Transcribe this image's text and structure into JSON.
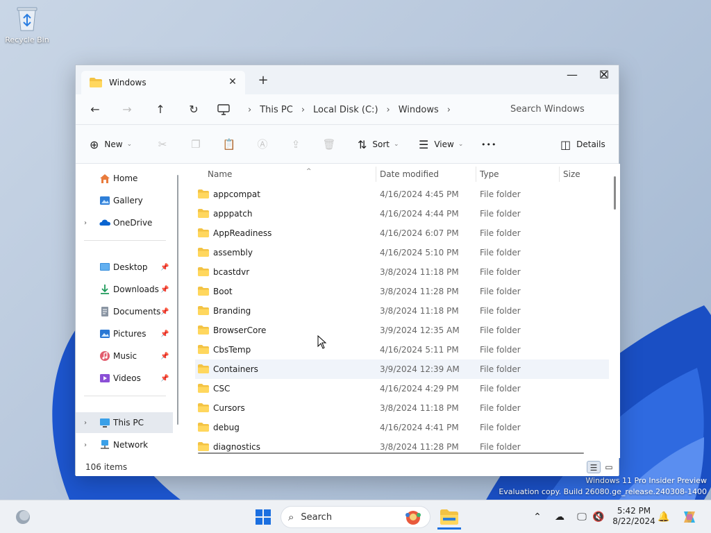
{
  "desktop": {
    "recycle_bin_label": "Recycle Bin",
    "watermark_line1": "Windows 11 Pro Insider Preview",
    "watermark_line2": "Evaluation copy. Build 26080.ge_release.240308-1400"
  },
  "window": {
    "tab_title": "Windows",
    "tab_close": "✕",
    "new_tab": "+",
    "minimize": "—",
    "maximize": "☐",
    "close": "✕"
  },
  "nav": {
    "back": "←",
    "forward": "→",
    "up": "↑",
    "refresh": "↻",
    "breadcrumb": [
      "This PC",
      "Local Disk (C:)",
      "Windows"
    ],
    "search_placeholder": "Search Windows"
  },
  "toolbar": {
    "new_label": "New",
    "sort_label": "Sort",
    "view_label": "View",
    "more_label": "•••",
    "details_label": "Details"
  },
  "sidebar": {
    "home": "Home",
    "gallery": "Gallery",
    "onedrive": "OneDrive",
    "desktop": "Desktop",
    "downloads": "Downloads",
    "documents": "Documents",
    "pictures": "Pictures",
    "music": "Music",
    "videos": "Videos",
    "this_pc": "This PC",
    "network": "Network"
  },
  "columns": {
    "name": "Name",
    "date": "Date modified",
    "type": "Type",
    "size": "Size"
  },
  "rows": [
    {
      "name": "appcompat",
      "date": "4/16/2024 4:45 PM",
      "type": "File folder"
    },
    {
      "name": "apppatch",
      "date": "4/16/2024 4:44 PM",
      "type": "File folder"
    },
    {
      "name": "AppReadiness",
      "date": "4/16/2024 6:07 PM",
      "type": "File folder"
    },
    {
      "name": "assembly",
      "date": "4/16/2024 5:10 PM",
      "type": "File folder"
    },
    {
      "name": "bcastdvr",
      "date": "3/8/2024 11:18 PM",
      "type": "File folder"
    },
    {
      "name": "Boot",
      "date": "3/8/2024 11:28 PM",
      "type": "File folder"
    },
    {
      "name": "Branding",
      "date": "3/8/2024 11:18 PM",
      "type": "File folder"
    },
    {
      "name": "BrowserCore",
      "date": "3/9/2024 12:35 AM",
      "type": "File folder"
    },
    {
      "name": "CbsTemp",
      "date": "4/16/2024 5:11 PM",
      "type": "File folder"
    },
    {
      "name": "Containers",
      "date": "3/9/2024 12:39 AM",
      "type": "File folder"
    },
    {
      "name": "CSC",
      "date": "4/16/2024 4:29 PM",
      "type": "File folder"
    },
    {
      "name": "Cursors",
      "date": "3/8/2024 11:18 PM",
      "type": "File folder"
    },
    {
      "name": "debug",
      "date": "4/16/2024 4:41 PM",
      "type": "File folder"
    },
    {
      "name": "diagnostics",
      "date": "3/8/2024 11:28 PM",
      "type": "File folder"
    }
  ],
  "status": {
    "item_count": "106 items"
  },
  "taskbar": {
    "search_label": "Search",
    "time": "5:42 PM",
    "date": "8/22/2024"
  }
}
